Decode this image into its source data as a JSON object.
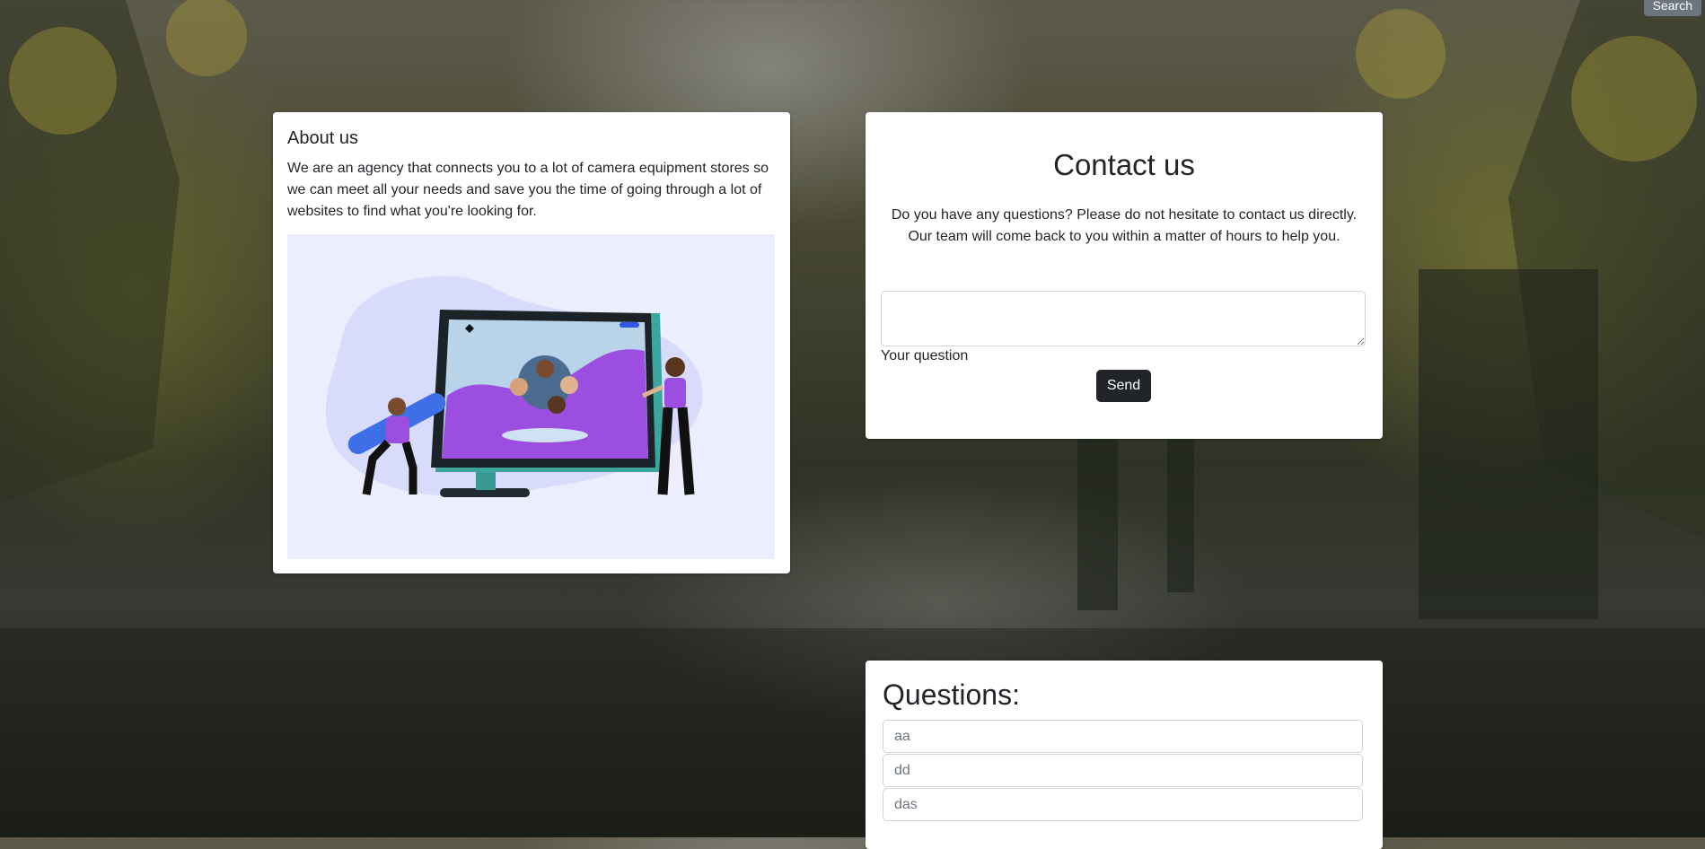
{
  "header": {
    "search_label": "Search"
  },
  "about": {
    "title": "About us",
    "text": "We are an agency that connects you to a lot of camera equipment stores so we can meet all your needs and save you the time of going through a lot of websites to find what you're looking for."
  },
  "contact": {
    "title": "Contact us",
    "text": "Do you have any questions? Please do not hesitate to contact us directly. Our team will come back to you within a matter of hours to help you.",
    "question_value": "",
    "question_label": "Your question",
    "send_label": "Send"
  },
  "questions": {
    "title": "Questions:",
    "items": [
      "aa",
      "dd",
      "das"
    ]
  },
  "colors": {
    "card_bg": "#ffffff",
    "button_dark": "#212529",
    "button_secondary": "#6c757d",
    "illustration_bg": "#eceefd",
    "illustration_purple": "#9b4ee0"
  },
  "icons": {
    "about_illustration": "team-video-call-illustration"
  }
}
